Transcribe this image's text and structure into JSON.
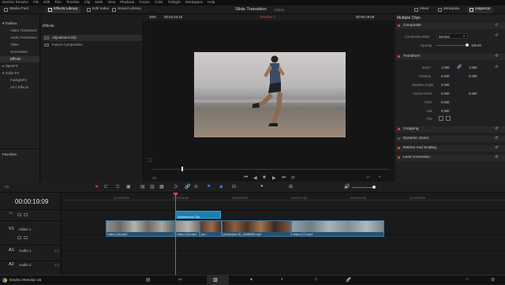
{
  "menu": [
    "DaVinci Resolve",
    "File",
    "Edit",
    "Trim",
    "Timeline",
    "Clip",
    "Mark",
    "View",
    "Playback",
    "Fusion",
    "Color",
    "Fairlight",
    "Workspace",
    "Help"
  ],
  "toolbar": {
    "media_pool": "Media Pool",
    "effects_library": "Effects Library",
    "edit_index": "Edit Index",
    "sound_library": "Sound Library",
    "project_title": "Slide Transition",
    "edited": "Edited",
    "mixer": "Mixer",
    "metadata": "Metadata",
    "inspector": "Inspector"
  },
  "left_panel": {
    "tree": [
      "Toolbox",
      "Video Transitions",
      "Audio Transitions",
      "Titles",
      "Generators",
      "Effects",
      "OpenFX",
      "Audio FX",
      "FairlightFX",
      "VST Effects"
    ],
    "favorites": "Favorites"
  },
  "effects_panel": {
    "header": "Effects",
    "items": [
      "Adjustment Clip",
      "Fusion Composition"
    ]
  },
  "viewer": {
    "zoom": "30%",
    "source_timecode": "00:02:23:10",
    "timeline_name": "Timeline 1",
    "record_timecode": "00:00:19:09"
  },
  "inspector": {
    "title": "Multiple Clips",
    "composite": {
      "header": "Composite",
      "mode_label": "Composite Mode",
      "mode_value": "Normal",
      "opacity_label": "Opacity",
      "opacity_value": "100.00"
    },
    "transform": {
      "header": "Transform",
      "zoom_label": "Zoom",
      "zoom_x": "1.000",
      "zoom_y": "1.000",
      "position_label": "Position",
      "position_x": "0.000",
      "position_y": "0.000",
      "rotation_label": "Rotation Angle",
      "rotation_value": "0.000",
      "anchor_label": "Anchor Point",
      "anchor_x": "0.000",
      "anchor_y": "0.000",
      "pitch_label": "Pitch",
      "pitch_value": "0.000",
      "yaw_label": "Yaw",
      "yaw_value": "0.000",
      "flip_label": "Flip"
    },
    "sections": [
      "Cropping",
      "Dynamic Zoom",
      "Retime And Scaling",
      "Lens Correction"
    ]
  },
  "timeline": {
    "timecode": "00:00:19:09",
    "ruler": [
      "01:00:00:00",
      "01:00:04:00",
      "01:00:08:00",
      "01:00:12:00",
      "01:00:16:00",
      "01:00:20:00"
    ],
    "tracks": {
      "v2": "V2",
      "v1": "V1",
      "video1": "Video 1",
      "a1": "A1",
      "audio1": "Audio 1",
      "a2": "A2",
      "audio2": "Audio 2",
      "a1_level": "2.0",
      "a2_level": "2.0"
    },
    "clips": [
      {
        "name": "video (16).mp4"
      },
      {
        "name": "video (16).mp4"
      },
      {
        "name": "pro..."
      },
      {
        "name": "production ID_4438998.mp4"
      },
      {
        "name": "video (17).mp4"
      }
    ],
    "adjustment_clip": "Adjustment Clip"
  },
  "status": {
    "app": "DaVinci Resolve 16"
  },
  "colors": {
    "accent": "#e44a3a",
    "clip_blue": "#28506f",
    "playhead": "#e44a3a"
  }
}
